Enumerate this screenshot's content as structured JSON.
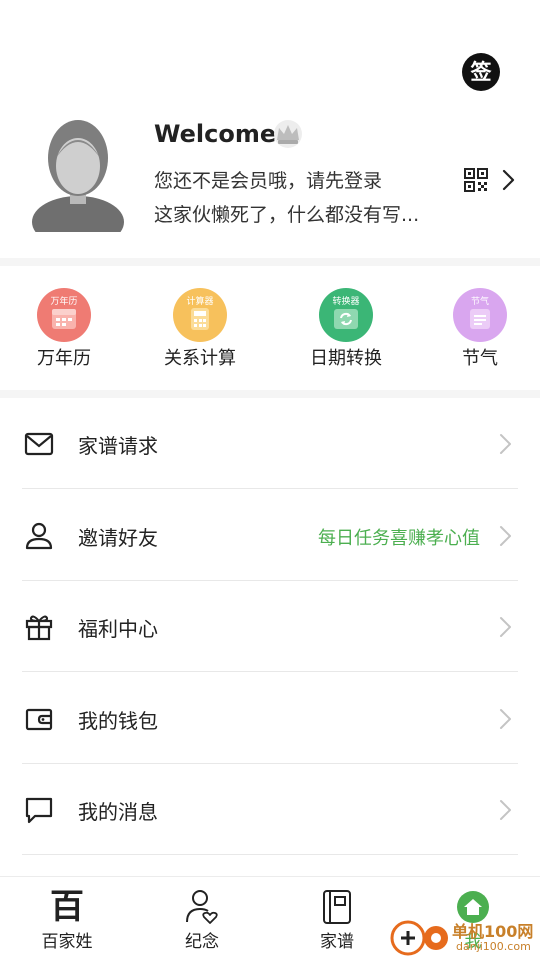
{
  "header": {
    "sign_label": "签",
    "welcome": "Welcome",
    "login_hint": "您还不是会员哦，请先登录",
    "motto": "这家伙懒死了，什么都没有写..."
  },
  "tools": [
    {
      "label": "万年历",
      "tag": "万年历",
      "color": "#ef7b73"
    },
    {
      "label": "关系计算",
      "tag": "计算器",
      "color": "#f7c15c"
    },
    {
      "label": "日期转换",
      "tag": "转换器",
      "color": "#3bb676"
    },
    {
      "label": "节气",
      "tag": "节气",
      "color": "#d9a6ef"
    }
  ],
  "menu": [
    {
      "label": "家谱请求",
      "extra": "",
      "icon": "mail-icon"
    },
    {
      "label": "邀请好友",
      "extra": "每日任务喜赚孝心值",
      "icon": "user-icon"
    },
    {
      "label": "福利中心",
      "extra": "",
      "icon": "gift-icon"
    },
    {
      "label": "我的钱包",
      "extra": "",
      "icon": "wallet-icon"
    },
    {
      "label": "我的消息",
      "extra": "",
      "icon": "message-icon"
    }
  ],
  "tabs": [
    {
      "label": "百家姓",
      "glyph": "百"
    },
    {
      "label": "纪念"
    },
    {
      "label": "家谱"
    },
    {
      "label": "我"
    }
  ],
  "watermark": {
    "brand": "单机100网",
    "site": "danji100.com"
  },
  "colors": {
    "accent": "#4caf50",
    "text": "#222222",
    "divider": "#e8e8e8"
  }
}
